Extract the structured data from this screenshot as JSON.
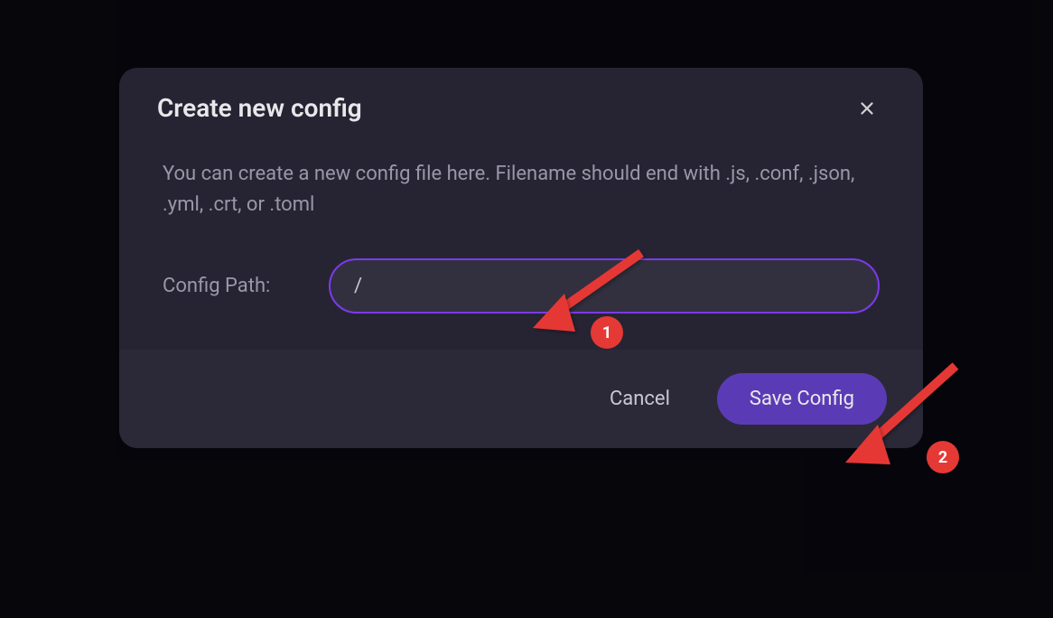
{
  "modal": {
    "title": "Create new config",
    "description": "You can create a new config file here. Filename should end with .js, .conf, .json, .yml, .crt, or .toml",
    "input_label": "Config Path:",
    "input_value": "/",
    "cancel_label": "Cancel",
    "save_label": "Save Config"
  },
  "annotations": {
    "badge_1": "1",
    "badge_2": "2"
  },
  "colors": {
    "accent": "#7c3aed",
    "button_primary": "#5b3bb5",
    "modal_bg": "#262433",
    "footer_bg": "#2b2938",
    "annotation": "#e53935"
  }
}
